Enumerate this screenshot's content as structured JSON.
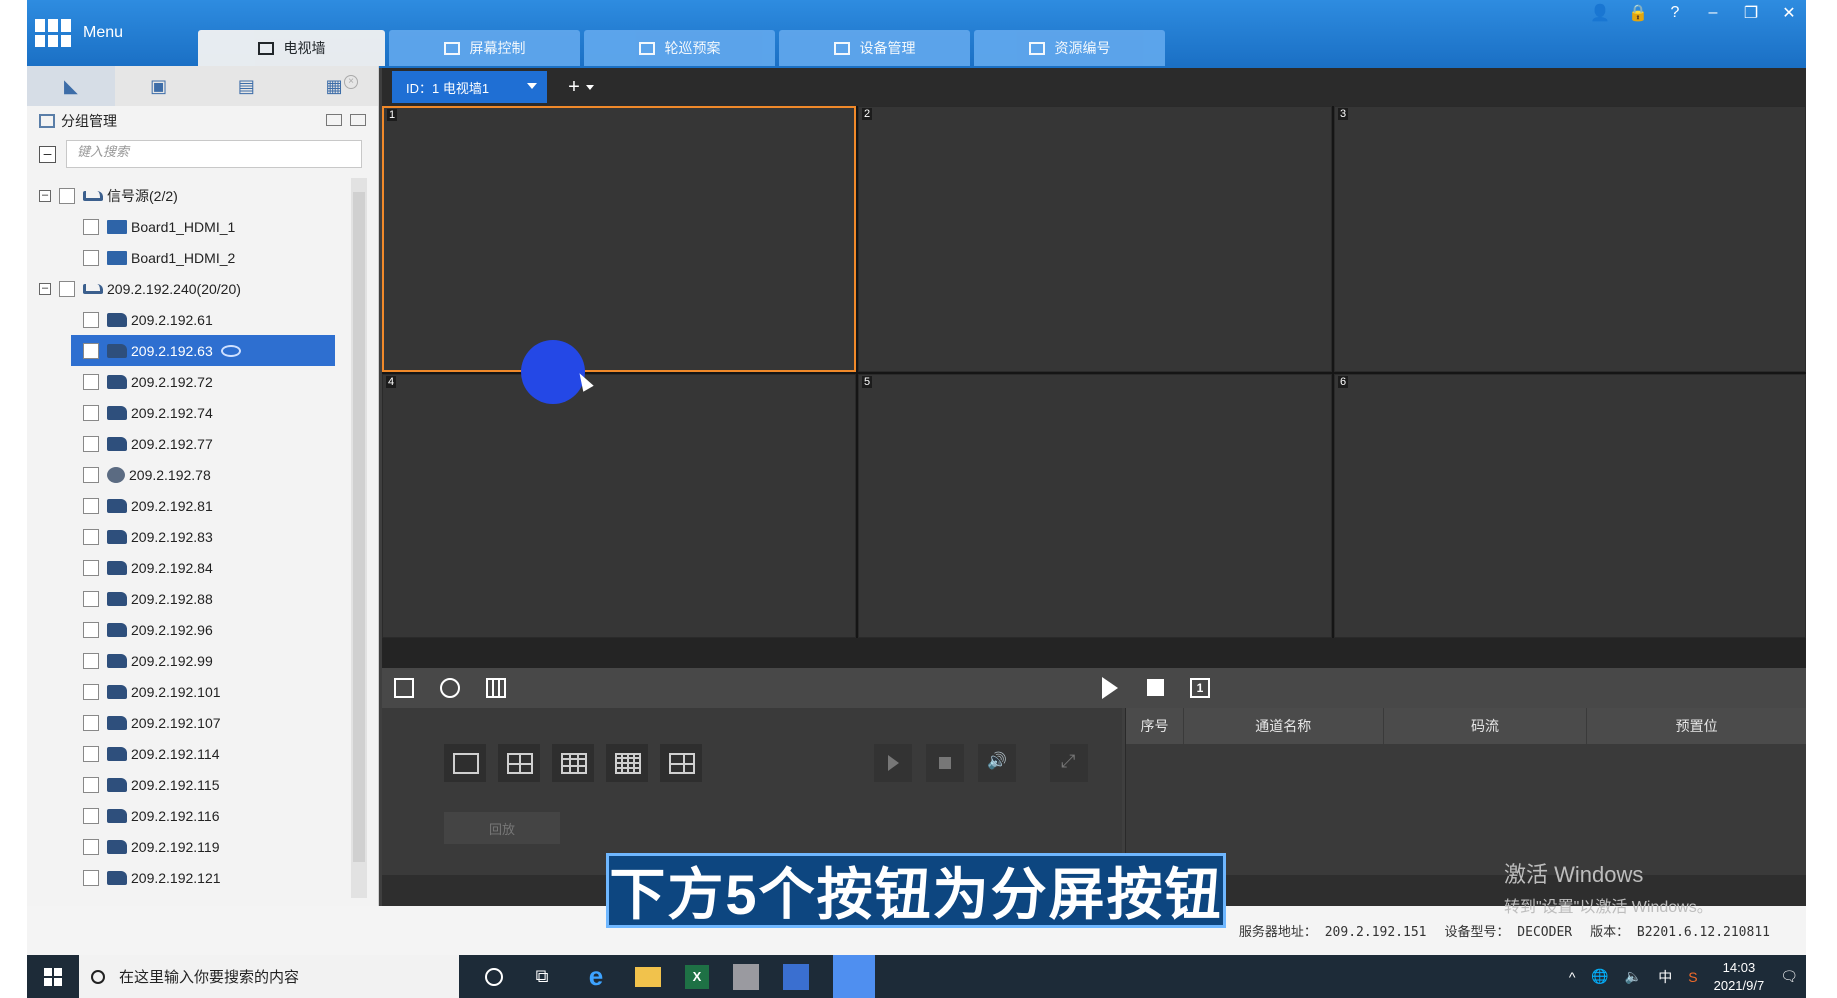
{
  "app": {
    "menu_label": "Menu",
    "tabs": [
      {
        "label": "电视墙",
        "active": true
      },
      {
        "label": "屏幕控制",
        "active": false
      },
      {
        "label": "轮巡预案",
        "active": false
      },
      {
        "label": "设备管理",
        "active": false
      },
      {
        "label": "资源编号",
        "active": false
      }
    ],
    "top_icons": [
      "user-icon",
      "lock-icon",
      "help-icon",
      "minimize-icon",
      "restore-icon",
      "close-icon"
    ]
  },
  "left_panel": {
    "tab_icons": [
      "camera-icon",
      "playback-icon",
      "video-icon",
      "screen-icon"
    ],
    "group_title": "分组管理",
    "search_placeholder": "键入搜索",
    "tree": [
      {
        "label": "信号源(2/2)",
        "level": 1,
        "type": "group"
      },
      {
        "label": "Board1_HDMI_1",
        "level": 2,
        "type": "hdmi"
      },
      {
        "label": "Board1_HDMI_2",
        "level": 2,
        "type": "hdmi"
      },
      {
        "label": "209.2.192.240(20/20)",
        "level": 1,
        "type": "group"
      },
      {
        "label": "209.2.192.61",
        "level": 2,
        "type": "camera"
      },
      {
        "label": "209.2.192.63",
        "level": 2,
        "type": "camera",
        "selected": true
      },
      {
        "label": "209.2.192.72",
        "level": 2,
        "type": "camera"
      },
      {
        "label": "209.2.192.74",
        "level": 2,
        "type": "camera"
      },
      {
        "label": "209.2.192.77",
        "level": 2,
        "type": "camera"
      },
      {
        "label": "209.2.192.78",
        "level": 2,
        "type": "dome"
      },
      {
        "label": "209.2.192.81",
        "level": 2,
        "type": "camera"
      },
      {
        "label": "209.2.192.83",
        "level": 2,
        "type": "camera"
      },
      {
        "label": "209.2.192.84",
        "level": 2,
        "type": "camera"
      },
      {
        "label": "209.2.192.88",
        "level": 2,
        "type": "camera"
      },
      {
        "label": "209.2.192.96",
        "level": 2,
        "type": "camera"
      },
      {
        "label": "209.2.192.99",
        "level": 2,
        "type": "camera"
      },
      {
        "label": "209.2.192.101",
        "level": 2,
        "type": "camera"
      },
      {
        "label": "209.2.192.107",
        "level": 2,
        "type": "camera"
      },
      {
        "label": "209.2.192.114",
        "level": 2,
        "type": "camera"
      },
      {
        "label": "209.2.192.115",
        "level": 2,
        "type": "camera"
      },
      {
        "label": "209.2.192.116",
        "level": 2,
        "type": "camera"
      },
      {
        "label": "209.2.192.119",
        "level": 2,
        "type": "camera"
      },
      {
        "label": "209.2.192.121",
        "level": 2,
        "type": "camera"
      }
    ]
  },
  "video": {
    "wall_select": "ID：1 电视墙1",
    "add_label": "+",
    "cells": [
      "1",
      "2",
      "3",
      "4",
      "5",
      "6"
    ],
    "active_cell": "1",
    "active_color": "#f0892a"
  },
  "bottom": {
    "clear_label": "回放",
    "table_headers": [
      "序号",
      "通道名称",
      "码流",
      "预置位"
    ]
  },
  "status": {
    "server": "服务器地址： 209.2.192.151",
    "device": "设备型号： DECODER",
    "version": "版本： B2201.6.12.210811"
  },
  "watermark": {
    "line1": "激活 Windows",
    "line2": "转到\"设置\"以激活 Windows。"
  },
  "caption": "下方5个按钮为分屏按钮",
  "taskbar": {
    "search_placeholder": "在这里输入你要搜索的内容",
    "tray_lang": "中",
    "time": "14:03",
    "date": "2021/9/7"
  }
}
